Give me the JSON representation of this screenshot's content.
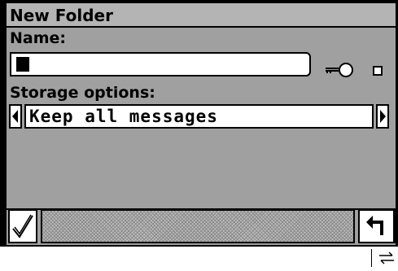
{
  "window": {
    "title": "New Folder"
  },
  "name_field": {
    "label": "Name:",
    "value": ""
  },
  "password": {
    "icon": "key-icon",
    "checked": false
  },
  "storage": {
    "label": "Storage options:",
    "value": "Keep all messages"
  },
  "toolbar": {
    "ok_icon": "checkmark-icon",
    "back_icon": "return-arrow-icon"
  },
  "status": {
    "icon": "sync-arrows-icon"
  }
}
